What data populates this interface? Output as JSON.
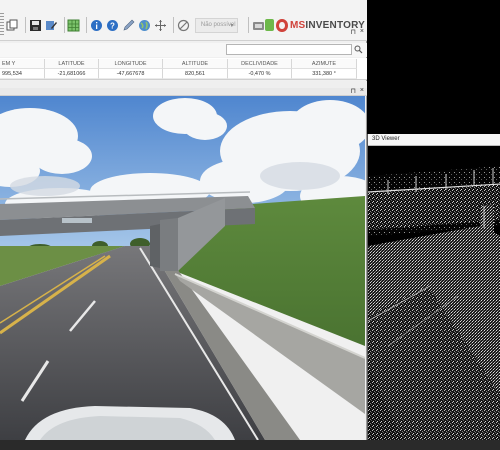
{
  "toolbar": {
    "combo_value": "Não possível",
    "combo_arrow": "▼",
    "icons": [
      "grip-icon",
      "copy-icon",
      "save-icon",
      "edit-icon",
      "grid-icon",
      "info-icon",
      "help-icon",
      "globe-icon",
      "move-icon",
      "no-entry-icon",
      "settings-icon"
    ]
  },
  "brand": {
    "prefix": "MS",
    "name": "INVENTORY",
    "colors": {
      "red": "#d0433b",
      "green": "#6db84a",
      "gray": "#4a4a4a"
    }
  },
  "data_panel": {
    "pin_glyph": "⊓",
    "close_glyph": "×",
    "columns": [
      "EM Y",
      "LATITUDE",
      "LONGITUDE",
      "ALTITUDE",
      "DECLIVIDADE",
      "AZIMUTE"
    ],
    "rows": [
      [
        "995,534",
        "-21,681066",
        "-47,667678",
        "820,561",
        "-0,470 %",
        "331,380 °"
      ]
    ]
  },
  "image_view": {
    "pin_glyph": "⊓",
    "close_glyph": "×"
  },
  "viewer_3d": {
    "title": "3D Viewer"
  }
}
